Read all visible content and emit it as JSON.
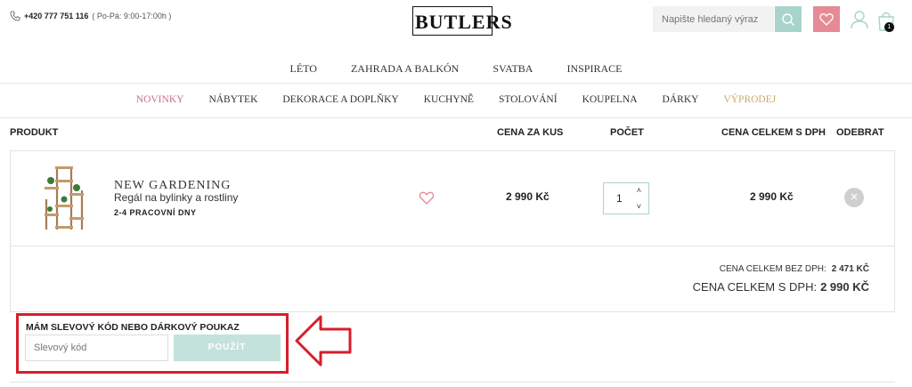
{
  "header": {
    "phone": "+420 777 751 116",
    "hours": "( Po-Pá: 9:00-17:00h )",
    "logo": "BUTLERS",
    "search_placeholder": "Napište hledaný výraz",
    "cart_count": "1",
    "icons": [
      "phone-icon",
      "search-icon",
      "heart-icon",
      "user-icon",
      "cart-icon"
    ]
  },
  "nav_top": [
    "LÉTO",
    "ZAHRADA A BALKÓN",
    "SVATBA",
    "INSPIRACE"
  ],
  "nav_main": [
    {
      "label": "NOVINKY",
      "color": "#c96f8a"
    },
    {
      "label": "NÁBYTEK",
      "color": "#333333"
    },
    {
      "label": "DEKORACE A DOPLŇKY",
      "color": "#333333"
    },
    {
      "label": "KUCHYNĚ",
      "color": "#333333"
    },
    {
      "label": "STOLOVÁNÍ",
      "color": "#333333"
    },
    {
      "label": "KOUPELNA",
      "color": "#333333"
    },
    {
      "label": "DÁRKY",
      "color": "#333333"
    },
    {
      "label": "VÝPRODEJ",
      "color": "#c9a96b"
    }
  ],
  "table": {
    "headers": {
      "product": "PRODUKT",
      "unit_price": "CENA ZA KUS",
      "quantity": "POČET",
      "total": "CENA CELKEM S DPH",
      "remove": "ODEBRAT"
    }
  },
  "item": {
    "brand": "NEW GARDENING",
    "name": "Regál na bylinky a rostliny",
    "delivery": "2-4 PRACOVNÍ DNY",
    "unit_price": "2 990 Kč",
    "quantity": "1",
    "total": "2 990 Kč",
    "remove": "×"
  },
  "summary": {
    "without_vat_label": "CENA CELKEM BEZ DPH:",
    "without_vat_value": "2 471 KČ",
    "with_vat_label": "CENA CELKEM S DPH:",
    "with_vat_value": "2 990 KČ"
  },
  "discount": {
    "label": "MÁM SLEVOVÝ KÓD NEBO DÁRKOVÝ POUKAZ",
    "placeholder": "Slevový kód",
    "button": "POUŽÍT"
  },
  "colors": {
    "accent_mint": "#a8d4cc",
    "accent_pink": "#e68a96",
    "highlight_red": "#d61e2b"
  }
}
